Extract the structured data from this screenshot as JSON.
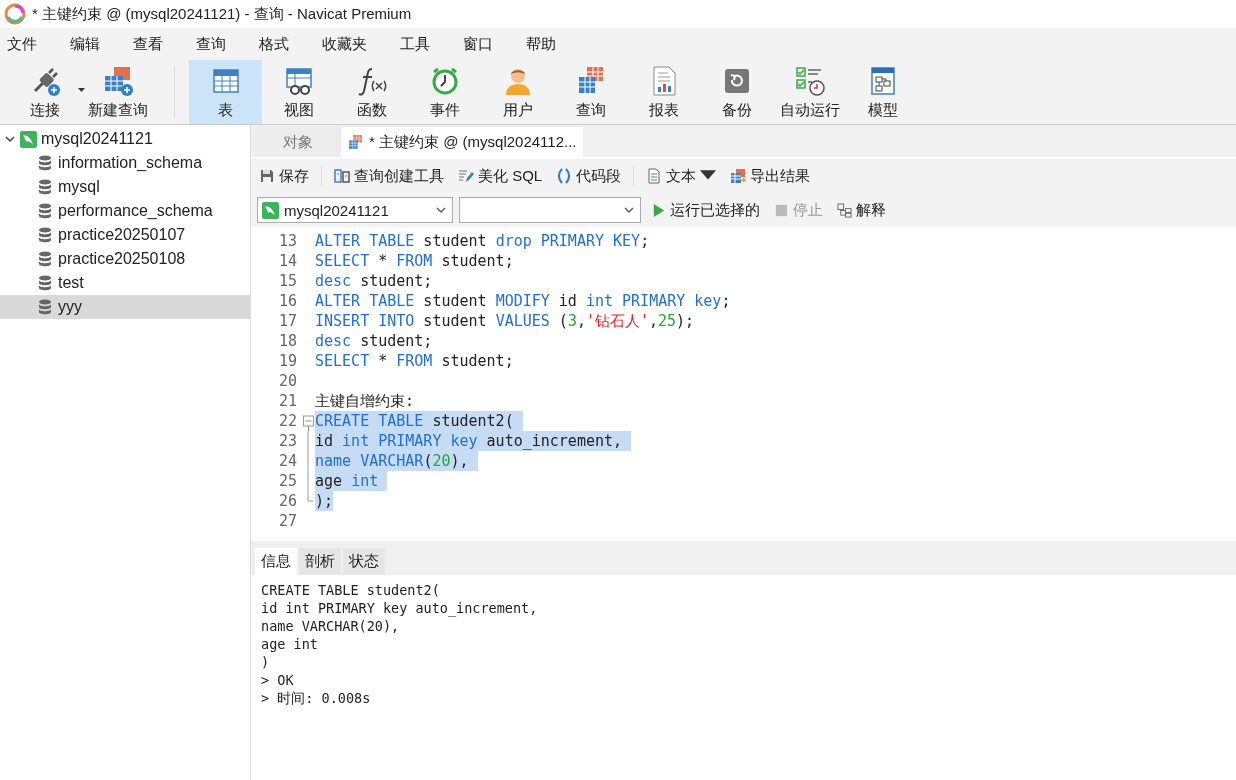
{
  "window": {
    "title": "* 主键约束 @ (mysql20241121) - 查询 - Navicat Premium"
  },
  "menu": [
    "文件",
    "编辑",
    "查看",
    "查询",
    "格式",
    "收藏夹",
    "工具",
    "窗口",
    "帮助"
  ],
  "toolbar": [
    {
      "kind": "connect",
      "label": "连接",
      "dropdown": true,
      "selected": false
    },
    {
      "kind": "new-query",
      "label": "新建查询",
      "dropdown": false,
      "selected": false
    },
    {
      "kind": "table",
      "label": "表",
      "dropdown": false,
      "selected": true
    },
    {
      "kind": "view",
      "label": "视图",
      "dropdown": false,
      "selected": false
    },
    {
      "kind": "function",
      "label": "函数",
      "dropdown": false,
      "selected": false
    },
    {
      "kind": "event",
      "label": "事件",
      "dropdown": false,
      "selected": false
    },
    {
      "kind": "user",
      "label": "用户",
      "dropdown": false,
      "selected": false
    },
    {
      "kind": "query",
      "label": "查询",
      "dropdown": false,
      "selected": false
    },
    {
      "kind": "report",
      "label": "报表",
      "dropdown": false,
      "selected": false
    },
    {
      "kind": "backup",
      "label": "备份",
      "dropdown": false,
      "selected": false
    },
    {
      "kind": "schedule",
      "label": "自动运行",
      "dropdown": false,
      "selected": false
    },
    {
      "kind": "model",
      "label": "模型",
      "dropdown": false,
      "selected": false
    }
  ],
  "sidebar": {
    "connection": {
      "label": "mysql20241121",
      "expanded": true,
      "children": [
        {
          "label": "information_schema",
          "selected": false
        },
        {
          "label": "mysql",
          "selected": false
        },
        {
          "label": "performance_schema",
          "selected": false
        },
        {
          "label": "practice20250107",
          "selected": false
        },
        {
          "label": "practice20250108",
          "selected": false
        },
        {
          "label": "test",
          "selected": false
        },
        {
          "label": "yyy",
          "selected": true
        }
      ]
    }
  },
  "tabs": [
    {
      "label": "对象",
      "selected": false,
      "kind": "objects"
    },
    {
      "label": "* 主键约束 @ (mysql2024112...",
      "selected": true,
      "kind": "query"
    }
  ],
  "actions": [
    {
      "kind": "save",
      "label": "保存",
      "dropdown": false
    },
    {
      "kind": "builder",
      "label": "查询创建工具",
      "dropdown": false
    },
    {
      "kind": "beautify",
      "label": "美化 SQL",
      "dropdown": false
    },
    {
      "kind": "snippet",
      "label": "代码段",
      "dropdown": false
    },
    {
      "kind": "text",
      "label": "文本",
      "dropdown": true
    },
    {
      "kind": "export",
      "label": "导出结果",
      "dropdown": false
    }
  ],
  "connection_select": {
    "value": "mysql20241121"
  },
  "run": [
    {
      "kind": "run",
      "label": "运行已选择的",
      "disabled": false
    },
    {
      "kind": "stop",
      "label": "停止",
      "disabled": true
    },
    {
      "kind": "explain",
      "label": "解释",
      "disabled": false
    }
  ],
  "editor": {
    "lines": [
      {
        "number": "13",
        "kind": "code",
        "selected": false,
        "tokens": [
          {
            "kind": "kw",
            "text": "ALTER TABLE"
          },
          {
            "kind": "id",
            "text": " student "
          },
          {
            "kind": "kw",
            "text": "drop PRIMARY KEY"
          },
          {
            "kind": "id",
            "text": ";"
          }
        ]
      },
      {
        "number": "14",
        "kind": "code",
        "selected": false,
        "tokens": [
          {
            "kind": "kw",
            "text": "SELECT"
          },
          {
            "kind": "id",
            "text": " * "
          },
          {
            "kind": "kw",
            "text": "FROM"
          },
          {
            "kind": "id",
            "text": " student;"
          }
        ]
      },
      {
        "number": "15",
        "kind": "code",
        "selected": false,
        "tokens": [
          {
            "kind": "kw",
            "text": "desc"
          },
          {
            "kind": "id",
            "text": " student;"
          }
        ]
      },
      {
        "number": "16",
        "kind": "code",
        "selected": false,
        "tokens": [
          {
            "kind": "kw",
            "text": "ALTER TABLE"
          },
          {
            "kind": "id",
            "text": " student "
          },
          {
            "kind": "kw",
            "text": "MODIFY"
          },
          {
            "kind": "id",
            "text": " id "
          },
          {
            "kind": "kw",
            "text": "int PRIMARY key"
          },
          {
            "kind": "id",
            "text": ";"
          }
        ]
      },
      {
        "number": "17",
        "kind": "code",
        "selected": false,
        "tokens": [
          {
            "kind": "kw",
            "text": "INSERT INTO"
          },
          {
            "kind": "id",
            "text": " student "
          },
          {
            "kind": "kw",
            "text": "VALUES"
          },
          {
            "kind": "id",
            "text": " ("
          },
          {
            "kind": "num",
            "text": "3"
          },
          {
            "kind": "id",
            "text": ","
          },
          {
            "kind": "str",
            "text": "'钻石人'"
          },
          {
            "kind": "id",
            "text": ","
          },
          {
            "kind": "num",
            "text": "25"
          },
          {
            "kind": "id",
            "text": ");"
          }
        ]
      },
      {
        "number": "18",
        "kind": "code",
        "selected": false,
        "tokens": [
          {
            "kind": "kw",
            "text": "desc"
          },
          {
            "kind": "id",
            "text": " student;"
          }
        ]
      },
      {
        "number": "19",
        "kind": "code",
        "selected": false,
        "tokens": [
          {
            "kind": "kw",
            "text": "SELECT"
          },
          {
            "kind": "id",
            "text": " * "
          },
          {
            "kind": "kw",
            "text": "FROM"
          },
          {
            "kind": "id",
            "text": " student;"
          }
        ]
      },
      {
        "number": "20",
        "kind": "code"
      },
      {
        "number": "21",
        "kind": "code",
        "selected": false,
        "tokens": [
          {
            "kind": "id",
            "text": "主键自增约束:"
          }
        ]
      },
      {
        "number": "22",
        "kind": "fold-start",
        "selected": true,
        "tokens": [
          {
            "kind": "kw",
            "text": "CREATE TABLE"
          },
          {
            "kind": "id",
            "text": " student2( "
          }
        ]
      },
      {
        "number": "23",
        "kind": "fold-body",
        "selected": true,
        "tokens": [
          {
            "kind": "id",
            "text": "id "
          },
          {
            "kind": "kw",
            "text": "int PRIMARY key"
          },
          {
            "kind": "id",
            "text": " auto_increment, "
          }
        ]
      },
      {
        "number": "24",
        "kind": "fold-body",
        "selected": true,
        "tokens": [
          {
            "kind": "kw",
            "text": "name VARCHAR"
          },
          {
            "kind": "id",
            "text": "("
          },
          {
            "kind": "num",
            "text": "20"
          },
          {
            "kind": "id",
            "text": "), "
          }
        ]
      },
      {
        "number": "25",
        "kind": "fold-body",
        "selected": true,
        "tokens": [
          {
            "kind": "id",
            "text": "age "
          },
          {
            "kind": "kw",
            "text": "int "
          }
        ]
      },
      {
        "number": "26",
        "kind": "fold-end",
        "selected": true,
        "tokens": [
          {
            "kind": "id",
            "text": ");"
          }
        ]
      },
      {
        "number": "27",
        "kind": "code"
      }
    ]
  },
  "result_tabs": [
    {
      "label": "信息",
      "selected": true
    },
    {
      "label": "剖析",
      "selected": false
    },
    {
      "label": "状态",
      "selected": false
    }
  ],
  "result_lines": [
    "CREATE TABLE student2(",
    "id int PRIMARY key auto_increment,",
    "name VARCHAR(20),",
    "age int",
    ")",
    "> OK",
    "> 时间: 0.008s"
  ]
}
